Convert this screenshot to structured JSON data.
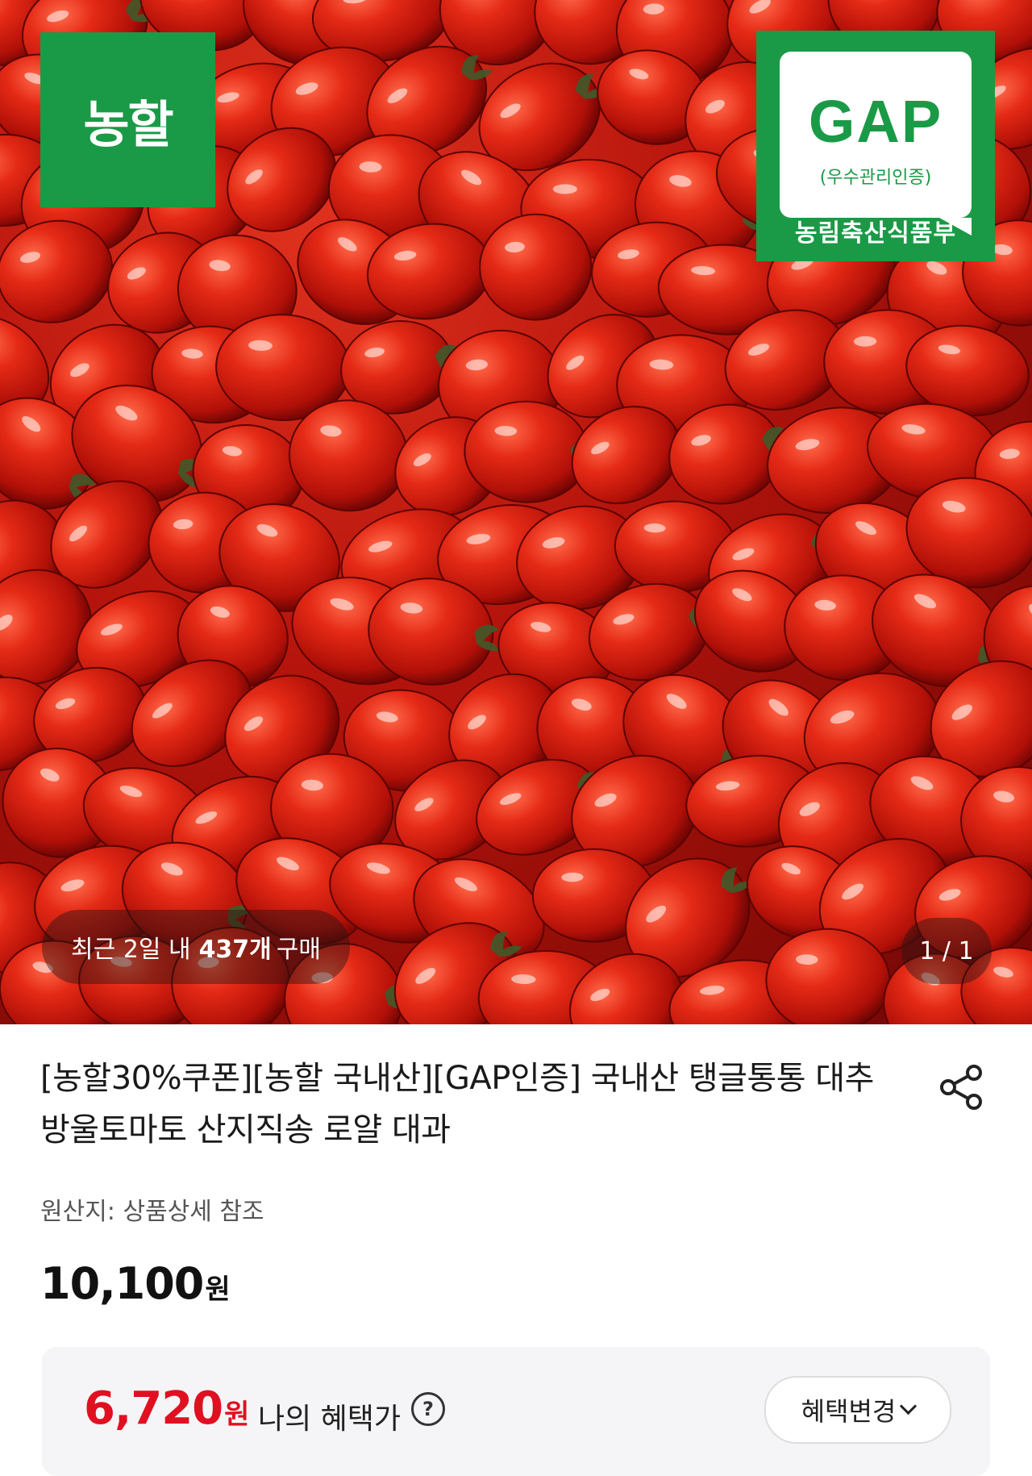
{
  "hero": {
    "image_alt": "방울토마토",
    "logo_text": "농할",
    "gap_badge": {
      "title": "GAP",
      "subtitle": "(우수관리인증)",
      "ministry": "농림축산식품부"
    },
    "recent_purchase": {
      "prefix": "최근 2일 내",
      "count": "437개",
      "suffix": "구매"
    },
    "pager": "1 / 1"
  },
  "product": {
    "title": "[농할30%쿠폰][농할 국내산][GAP인증] 국내산 탱글통통 대추 방울토마토 산지직송 로얄 대과",
    "origin_label": "원산지:",
    "origin_value": "상품상세 참조",
    "price": "10,100",
    "price_unit": "원"
  },
  "benefit": {
    "price": "6,720",
    "price_unit": "원",
    "label": "나의 혜택가",
    "help": "?",
    "change_button": "혜택변경"
  },
  "colors": {
    "green": "#1a9a46",
    "sale_red": "#e01020"
  }
}
